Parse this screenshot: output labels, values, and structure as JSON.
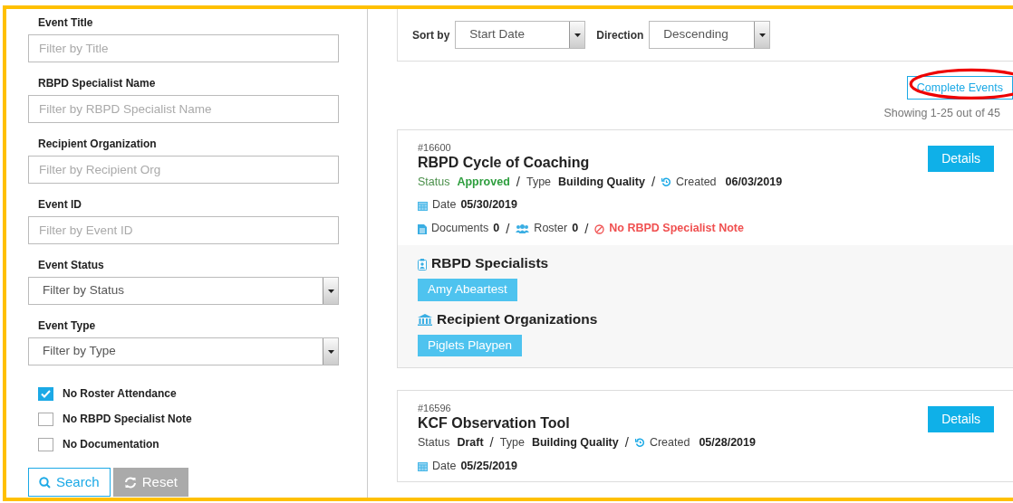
{
  "filters": [
    {
      "kind": "text",
      "label": "Event Title",
      "placeholder": "Filter by Title"
    },
    {
      "kind": "text",
      "label": "RBPD Specialist Name",
      "placeholder": "Filter by RBPD Specialist Name"
    },
    {
      "kind": "text",
      "label": "Recipient Organization",
      "placeholder": "Filter by Recipient Org"
    },
    {
      "kind": "text",
      "label": "Event ID",
      "placeholder": "Filter by Event ID"
    },
    {
      "kind": "select",
      "label": "Event Status",
      "value": "Filter by Status"
    },
    {
      "kind": "select",
      "label": "Event Type",
      "value": "Filter by Type"
    }
  ],
  "checkboxes": [
    {
      "label": "No Roster Attendance",
      "checked": true
    },
    {
      "label": "No RBPD Specialist Note",
      "checked": false
    },
    {
      "label": "No Documentation",
      "checked": false
    }
  ],
  "buttons": {
    "search": "Search",
    "reset": "Reset"
  },
  "sort": {
    "sort_label": "Sort by",
    "sort_value": "Start Date",
    "direction_label": "Direction",
    "direction_value": "Descending"
  },
  "complete_button": {
    "label": "Complete Events",
    "highlighted": true
  },
  "showing": "Showing 1-25 out of 45",
  "separator": "/",
  "events": [
    {
      "id": "#16600",
      "title": "RBPD Cycle of Coaching",
      "status_label": "Status",
      "status": "Approved",
      "approved": true,
      "type_label": "Type",
      "type": "Building Quality",
      "created_label": "Created",
      "created": "06/03/2019",
      "date_label": "Date",
      "date": "05/30/2019",
      "documents_label": "Documents",
      "documents": "0",
      "roster_label": "Roster",
      "roster": "0",
      "note": "No RBPD Specialist Note",
      "details": "Details",
      "specialists_title": "RBPD Specialists",
      "specialists": [
        "Amy Abeartest"
      ],
      "orgs_title": "Recipient Organizations",
      "orgs": [
        "Piglets Playpen"
      ]
    },
    {
      "id": "#16596",
      "title": "KCF Observation Tool",
      "status_label": "Status",
      "status": "Draft",
      "approved": false,
      "type_label": "Type",
      "type": "Building Quality",
      "created_label": "Created",
      "created": "05/28/2019",
      "date_label": "Date",
      "date": "05/25/2019",
      "details": "Details"
    }
  ]
}
